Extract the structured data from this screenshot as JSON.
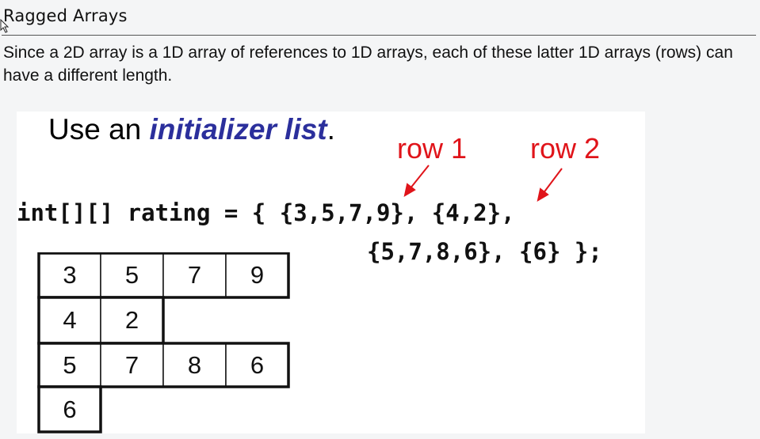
{
  "header": {
    "title": "Ragged Arrays"
  },
  "intro": {
    "text": "Since a 2D array is a 1D array of references to 1D arrays, each of these latter 1D arrays (rows) can have a different length."
  },
  "slide": {
    "title_prefix": "Use an ",
    "title_keyword": "initializer list",
    "title_suffix": ".",
    "labels": {
      "row1": "row 1",
      "row2": "row 2"
    },
    "code": {
      "line1": "int[][] rating = { {3,5,7,9}, {4,2},",
      "line2": "{5,7,8,6}, {6} };"
    },
    "rows": [
      [
        "3",
        "5",
        "7",
        "9"
      ],
      [
        "4",
        "2"
      ],
      [
        "5",
        "7",
        "8",
        "6"
      ],
      [
        "6"
      ]
    ]
  },
  "colors": {
    "keyword": "#2b2f9c",
    "annotation": "#e0141a"
  }
}
